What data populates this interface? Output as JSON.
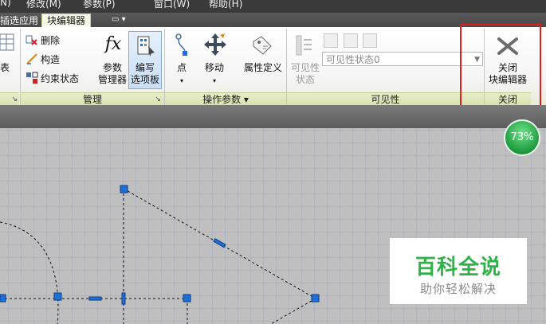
{
  "menu": {
    "items": [
      "N)",
      "修改(M)",
      "参数(P)",
      "窗口(W)",
      "帮助(H)"
    ]
  },
  "tabs": {
    "prev_label": "插选应用",
    "active_label": "块编辑器",
    "dropdown_glyph": "▭ ▾"
  },
  "ribbon": {
    "cut_label": "表",
    "manage": {
      "delete_label": "删除",
      "construct_label": "构造",
      "constraint_status_label": "约束状态",
      "param_manager_line1": "参数",
      "param_manager_line2": "管理器",
      "fx_glyph": "fx",
      "editor_line1": "编写",
      "editor_line2": "选项板",
      "panel_title": "管理",
      "launcher": "↘"
    },
    "operation": {
      "point_label": "点",
      "move_label": "移动",
      "attr_def_label": "属性定义",
      "panel_title": "操作参数 ▾"
    },
    "visibility": {
      "state_line1": "可见性",
      "state_line2": "状态",
      "select_value": "可见性状态0",
      "panel_title": "可见性"
    },
    "close": {
      "line1": "关闭",
      "line2": "块编辑器",
      "panel_title": "关闭"
    },
    "left_panel_launcher": "↘"
  },
  "canvas": {
    "zoom_label": "73%"
  },
  "watermark": {
    "title": "百科全说",
    "subtitle": "助你轻松解决"
  },
  "colors": {
    "grip_blue": "#1e6fd9",
    "highlight_red": "#e31c1c",
    "watermark_green": "#2db345"
  }
}
